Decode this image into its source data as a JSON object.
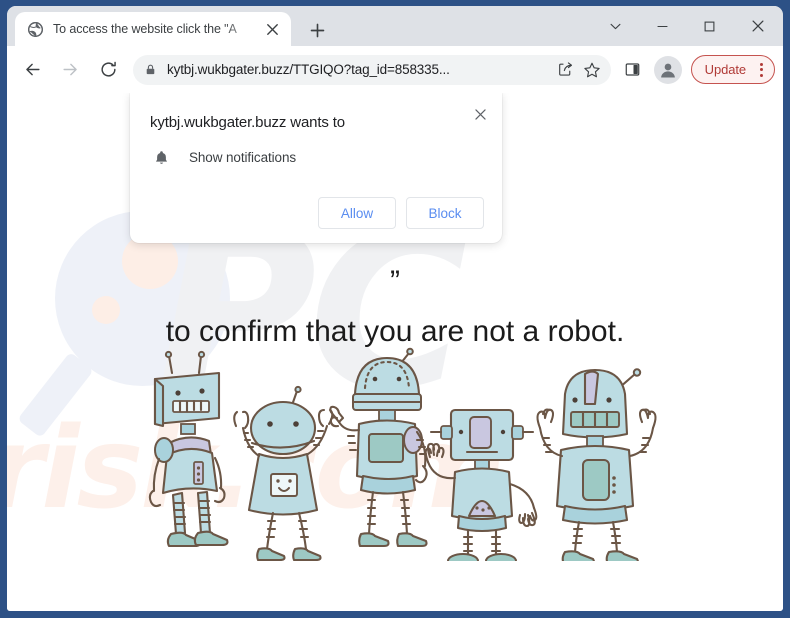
{
  "window": {
    "controls": [
      {
        "name": "tab-search-chevron",
        "glyph": "chevron-down-icon"
      },
      {
        "name": "minimize",
        "glyph": "minimize-icon"
      },
      {
        "name": "maximize",
        "glyph": "maximize-icon"
      },
      {
        "name": "close",
        "glyph": "close-icon"
      }
    ]
  },
  "tabs": {
    "active": {
      "title": "To access the website click the \"A",
      "favicon": "globe-icon",
      "close_label": "×"
    },
    "new_tab_label": "+"
  },
  "toolbar": {
    "back_label": "back-arrow-icon",
    "forward_label": "forward-arrow-icon",
    "reload_label": "reload-icon",
    "url": "kytbj.wukbgater.buzz/TTGIQO?tag_id=858335...",
    "lock_icon": "lock-icon",
    "share_icon": "share-icon",
    "bookmark_icon": "star-icon",
    "side_panel_icon": "side-panel-icon",
    "profile_icon": "profile-avatar-icon",
    "update_label": "Update",
    "menu_icon": "three-dot-menu-icon",
    "accent_update_border": "#c5534f",
    "accent_update_text": "#b03a36",
    "accent_update_bg": "#fdf2f1"
  },
  "permission_dialog": {
    "title": "kytbj.wukbgater.buzz wants to",
    "close_label": "×",
    "permission_icon": "bell-icon",
    "permission_label": "Show notifications",
    "allow_label": "Allow",
    "block_label": "Block",
    "button_text_color": "#5a8df0"
  },
  "page": {
    "headline_hidden_tail": "”",
    "headline_main": "to confirm that you are not a robot.",
    "illustration": "five-cartoon-robots-illustration",
    "watermark_primary": "PC",
    "watermark_secondary": "risk.com"
  }
}
